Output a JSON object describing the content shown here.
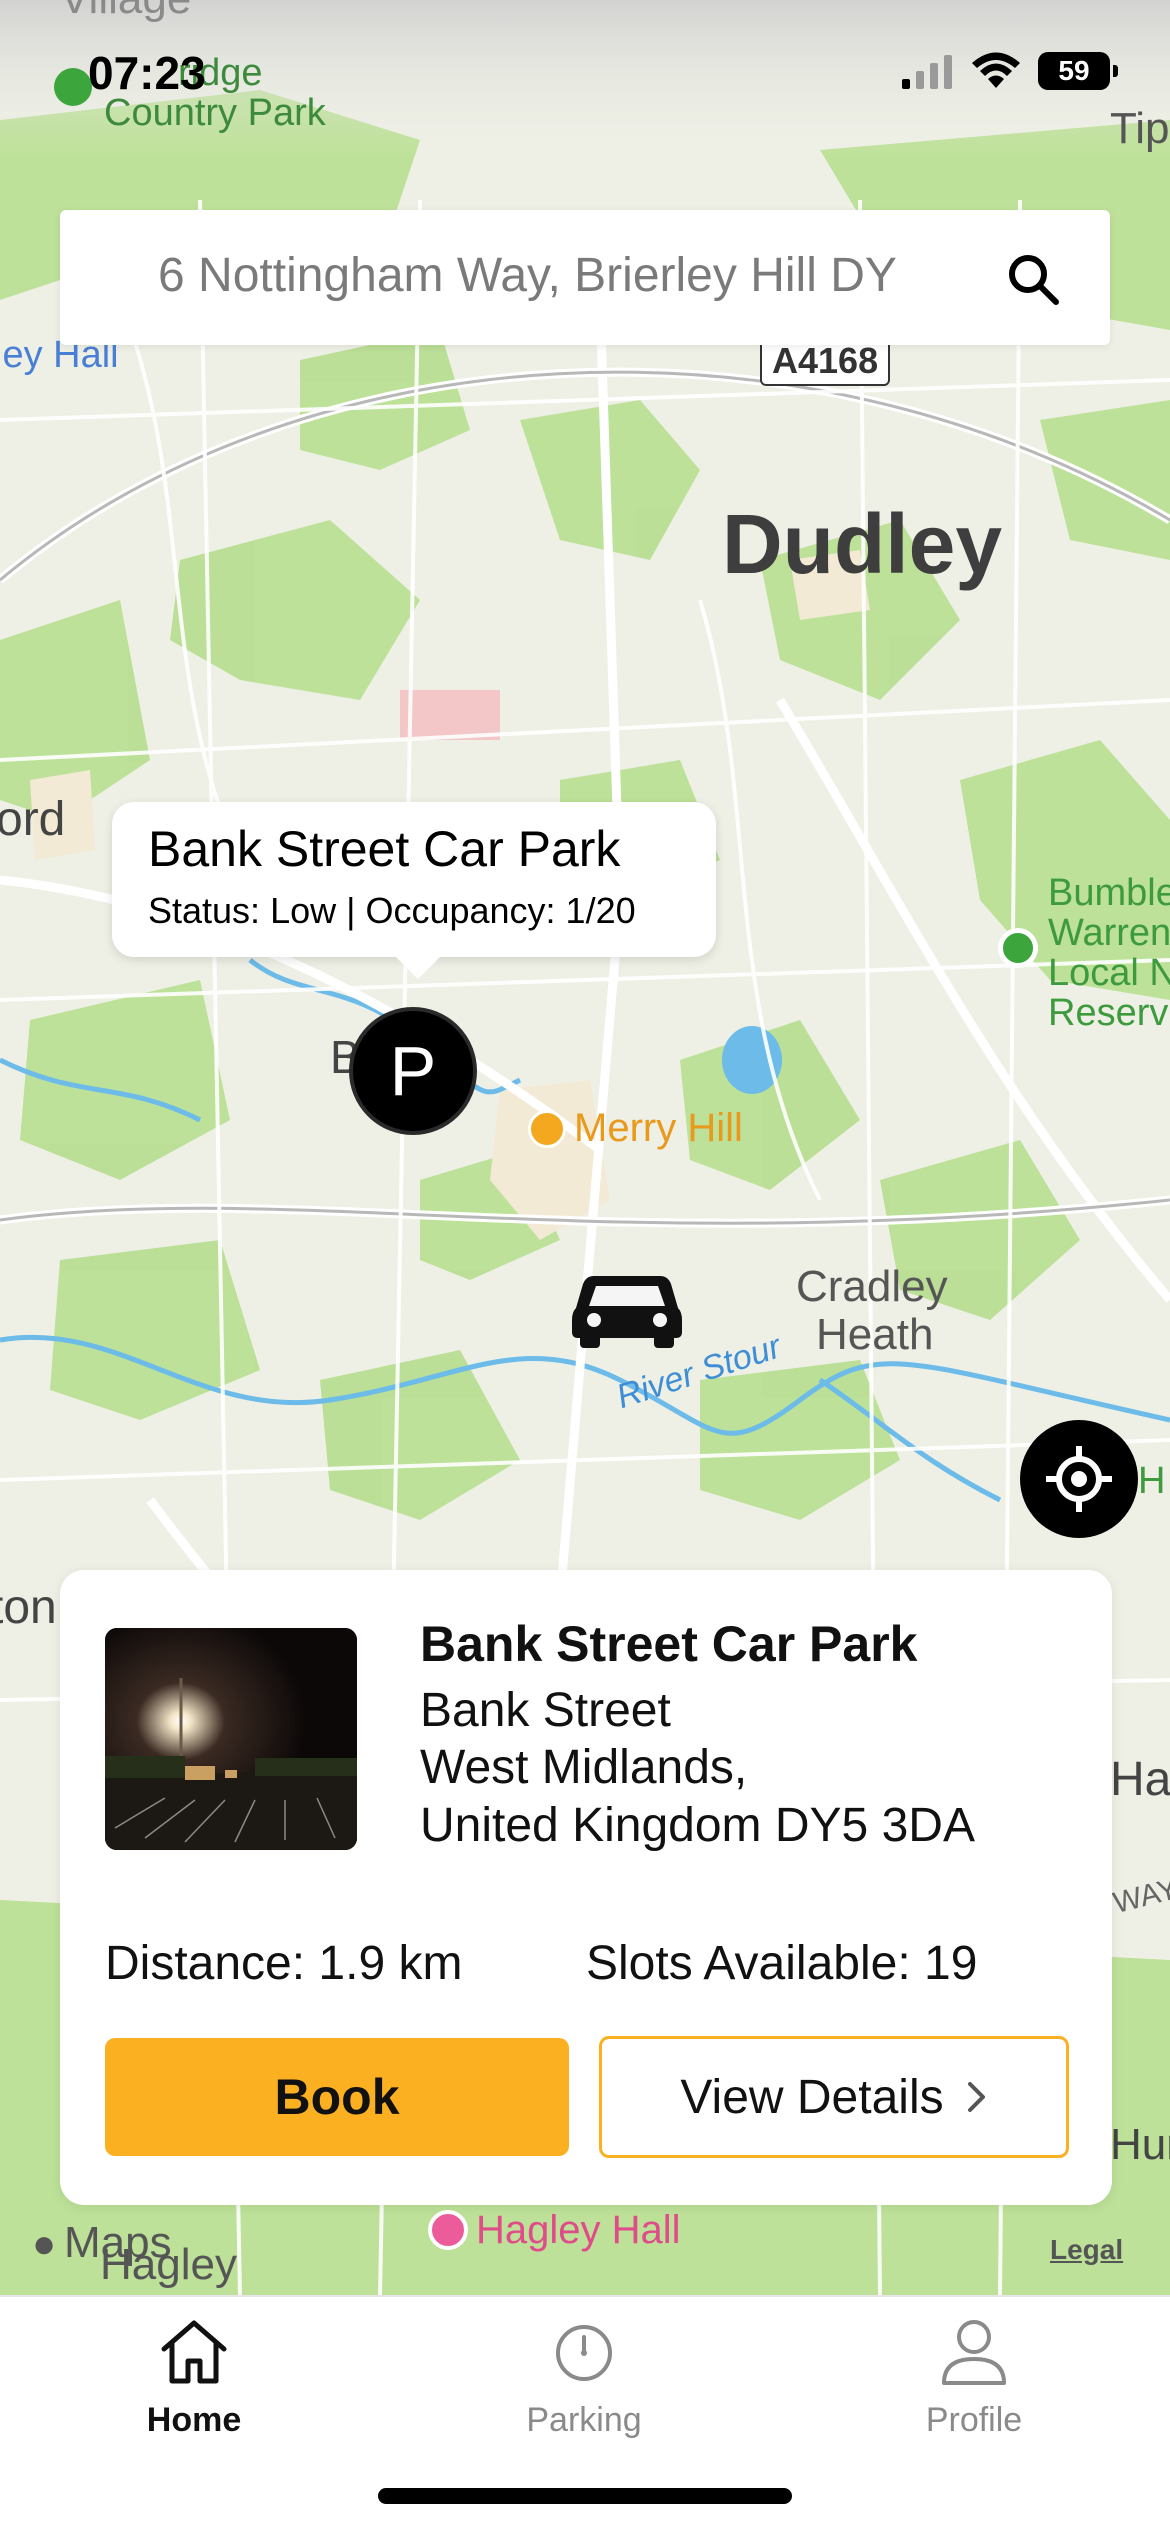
{
  "status_bar": {
    "time": "07:23",
    "battery": "59"
  },
  "search": {
    "value": "6 Nottingham Way, Brierley Hill DY"
  },
  "map": {
    "labels": {
      "top_left": "Village",
      "park": "Country Park",
      "park_partial": "ridge",
      "top_right": "Tip",
      "hall_left": "ley Hall",
      "road": "A4168",
      "city": "Dudley",
      "left_edge": "ord",
      "reserve": [
        "Bumble",
        "Warren",
        "Local N",
        "Reserv"
      ],
      "brierley": "B       y",
      "merry_hill": "Merry Hill",
      "cradley": [
        "Cradley",
        "Heath"
      ],
      "river": "River Stour",
      "right_edge_h": "H",
      "left_edge_2": "ton",
      "right_edge_ha": "Ha",
      "right_edge_way": "WAY",
      "right_edge_hu": "Hur",
      "hagley_hall": "Hagley Hall",
      "hagley": "Hagley",
      "maps": "Maps",
      "legal": "Legal"
    },
    "colors": {
      "land": "#eef0e6",
      "green": "#b5dd8f",
      "water": "#5fb3e8",
      "road": "#ffffff",
      "urban": "#f2e9d8"
    }
  },
  "callout": {
    "title": "Bank Street Car Park",
    "status": "Status: Low | Occupancy: 1/20"
  },
  "parking_pin": {
    "letter": "P"
  },
  "card": {
    "name": "Bank Street Car Park",
    "address": [
      "Bank Street",
      "West Midlands,",
      "United Kingdom DY5 3DA"
    ],
    "distance": "Distance: 1.9 km",
    "slots": "Slots Available: 19",
    "book_label": "Book",
    "details_label": "View Details",
    "accent_color": "#fbb022"
  },
  "tabs": [
    {
      "label": "Home",
      "icon": "home-icon",
      "active": true
    },
    {
      "label": "Parking",
      "icon": "parking-timer-icon",
      "active": false
    },
    {
      "label": "Profile",
      "icon": "profile-icon",
      "active": false
    }
  ]
}
